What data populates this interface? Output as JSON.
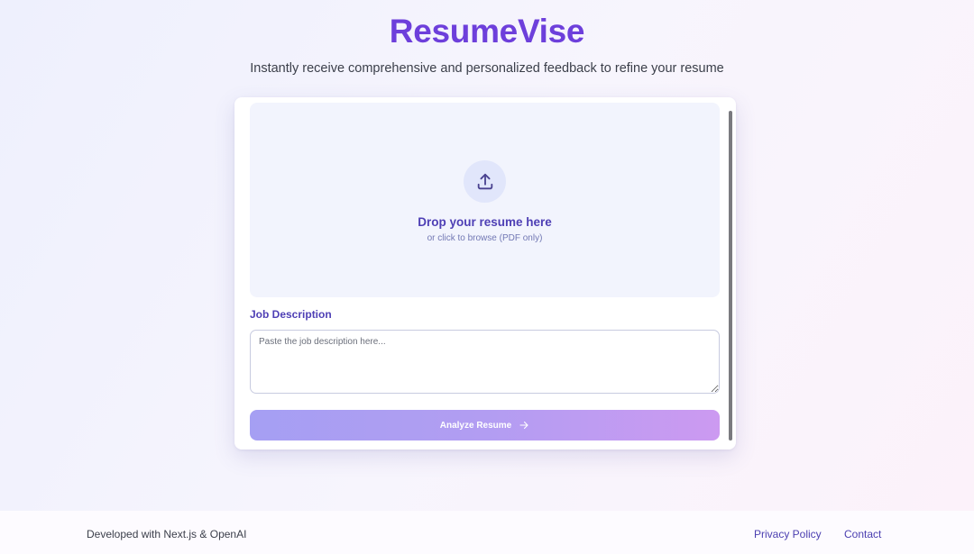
{
  "header": {
    "app_title": "ResumeVise",
    "subtitle": "Instantly receive comprehensive and personalized feedback to refine your resume"
  },
  "upload": {
    "icon": "upload-icon",
    "title": "Drop your resume here",
    "hint": "or click to browse (PDF only)"
  },
  "job_description": {
    "label": "Job Description",
    "placeholder": "Paste the job description here...",
    "value": ""
  },
  "analyze_button": {
    "label": "Analyze Resume",
    "icon": "arrow-right-icon"
  },
  "footer": {
    "credit": "Developed with Next.js & OpenAI",
    "links": [
      {
        "label": "Privacy Policy"
      },
      {
        "label": "Contact"
      }
    ]
  },
  "colors": {
    "brand": "#6d3fdb",
    "accent": "#4e3fb5",
    "button_gradient_start": "#a59ff3",
    "button_gradient_end": "#cc9af1"
  }
}
